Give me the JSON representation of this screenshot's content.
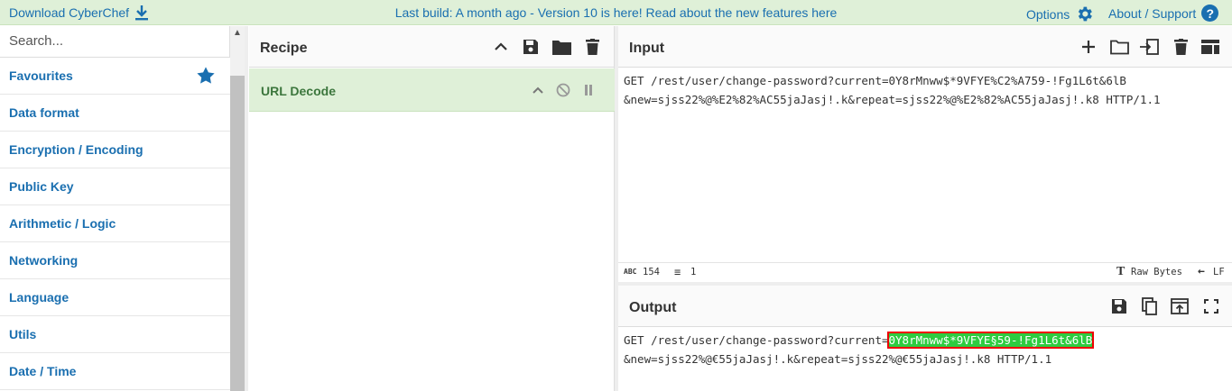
{
  "banner": {
    "download_label": "Download CyberChef",
    "notice": "Last build: A month ago - Version 10 is here! Read about the new features here",
    "options_label": "Options",
    "about_label": "About / Support"
  },
  "operations": {
    "search_placeholder": "Search...",
    "categories": [
      "Favourites",
      "Data format",
      "Encryption / Encoding",
      "Public Key",
      "Arithmetic / Logic",
      "Networking",
      "Language",
      "Utils",
      "Date / Time"
    ]
  },
  "recipe": {
    "title": "Recipe",
    "operation_name": "URL Decode"
  },
  "input": {
    "title": "Input",
    "line1": "GET /rest/user/change-password?current=0Y8rMnww$*9VFYE%C2%A759-!Fg1L6t&6lB",
    "line2": "&new=sjss22%@%E2%82%AC55jaJasj!.k&repeat=sjss22%@%E2%82%AC55jaJasj!.k8 HTTP/1.1",
    "length_label": "154",
    "lines_label": "1",
    "encoding_label": "Raw Bytes",
    "eol_label": "LF"
  },
  "output": {
    "title": "Output",
    "line1_prefix": "GET /rest/user/change-password?current=",
    "line1_highlight": "0Y8rMnww$*9VFYE§59-!Fg1L6t&6lB",
    "line2": "&new=sjss22%@€55jaJasj!.k&repeat=sjss22%@€55jaJasj!.k8 HTTP/1.1"
  },
  "colors": {
    "banner_bg": "#dff0d8",
    "link": "#1a6fb0",
    "recipe_op_bg": "#dff0d8",
    "recipe_op_text": "#3c763d",
    "highlight_bg": "#2ecc40",
    "highlight_border": "#ee0000"
  }
}
